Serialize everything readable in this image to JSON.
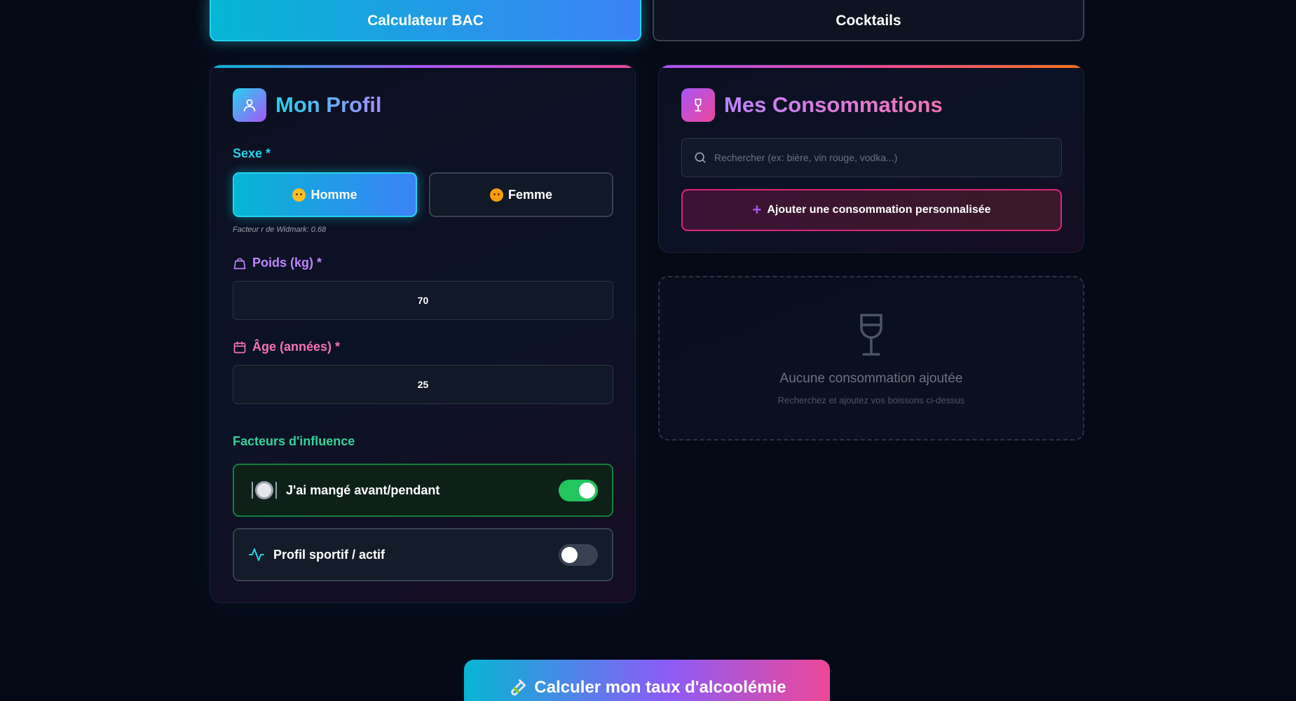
{
  "tabs": [
    {
      "label": "Calculateur BAC",
      "active": true
    },
    {
      "label": "Cocktails",
      "active": false
    }
  ],
  "profile": {
    "title": "Mon Profil",
    "sex_label": "Sexe *",
    "sex_options": [
      {
        "label": "Homme",
        "selected": true,
        "icon": "man-face-icon"
      },
      {
        "label": "Femme",
        "selected": false,
        "icon": "woman-face-icon"
      }
    ],
    "widmark_note": "Facteur r de Widmark: 0.68",
    "weight_label": "Poids (kg) *",
    "weight_value": "70",
    "age_label": "Âge (années) *",
    "age_value": "25",
    "factors_label": "Facteurs d'influence",
    "factors": [
      {
        "label": "J'ai mangé avant/pendant",
        "on": true,
        "icon": "plate-icon"
      },
      {
        "label": "Profil sportif / actif",
        "on": false,
        "icon": "activity-icon"
      }
    ]
  },
  "consumptions": {
    "title": "Mes Consommations",
    "search_placeholder": "Rechercher (ex: bière, vin rouge, vodka...)",
    "add_label": "Ajouter une consommation personnalisée",
    "empty_title": "Aucune consommation ajoutée",
    "empty_subtitle": "Recherchez et ajoutez vos boissons ci-dessus"
  },
  "calculate_label": "Calculer mon taux d'alcoolémie",
  "colors": {
    "cyan": "#22d3ee",
    "blue": "#3b82f6",
    "purple": "#a855f7",
    "pink": "#ec4899",
    "green": "#22c55e",
    "background": "#060a17"
  }
}
